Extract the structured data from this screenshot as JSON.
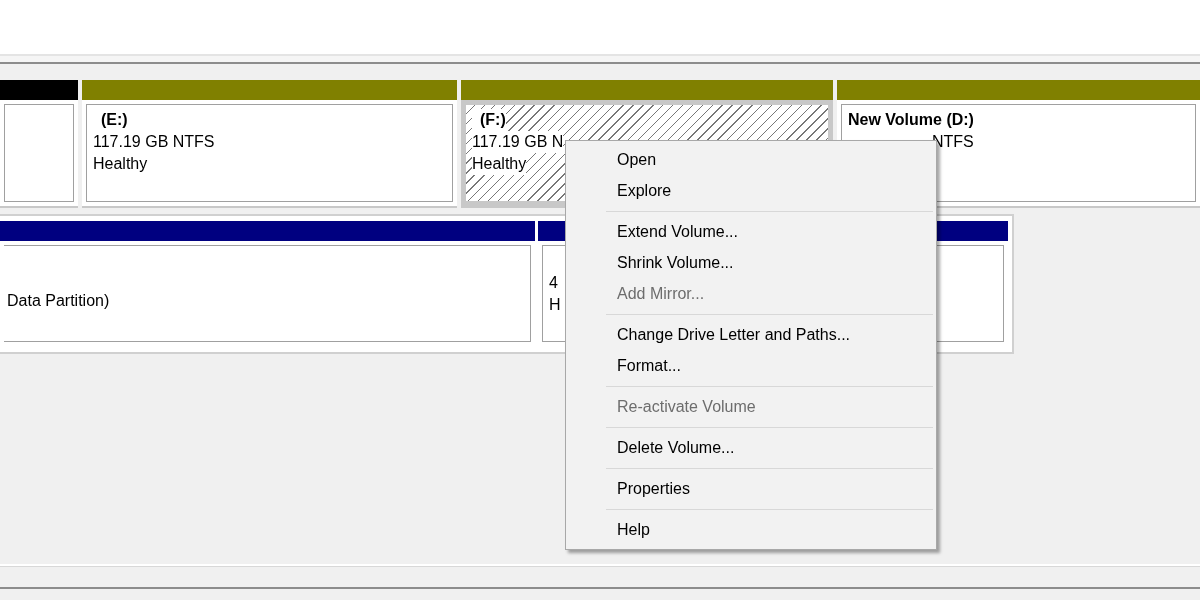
{
  "disks": [
    {
      "partitions": [
        {
          "color": "#000000",
          "selected": false
        },
        {
          "color": "#808000",
          "selected": false,
          "name": "(E:)",
          "size": "117.19 GB NTFS",
          "status": "Healthy"
        },
        {
          "color": "#808000",
          "selected": true,
          "name": "(F:)",
          "size": "117.19 GB N",
          "status": "Healthy"
        },
        {
          "color": "#808000",
          "selected": false,
          "name": "New Volume  (D:)",
          "size": "NTFS"
        }
      ]
    },
    {
      "partitions": [
        {
          "color": "#000080",
          "selected": false,
          "size": "Data Partition)"
        },
        {
          "color": "#000080",
          "selected": false,
          "size": "4",
          "status": "H"
        }
      ]
    }
  ],
  "context_menu": {
    "groups": [
      [
        {
          "label": "Open",
          "disabled": false
        },
        {
          "label": "Explore",
          "disabled": false
        }
      ],
      [
        {
          "label": "Extend Volume...",
          "disabled": false
        },
        {
          "label": "Shrink Volume...",
          "disabled": false
        },
        {
          "label": "Add Mirror...",
          "disabled": true
        }
      ],
      [
        {
          "label": "Change Drive Letter and Paths...",
          "disabled": false
        },
        {
          "label": "Format...",
          "disabled": false
        }
      ],
      [
        {
          "label": "Re-activate Volume",
          "disabled": true
        }
      ],
      [
        {
          "label": "Delete Volume...",
          "disabled": false
        }
      ],
      [
        {
          "label": "Properties",
          "disabled": false
        }
      ],
      [
        {
          "label": "Help",
          "disabled": false
        }
      ]
    ]
  }
}
